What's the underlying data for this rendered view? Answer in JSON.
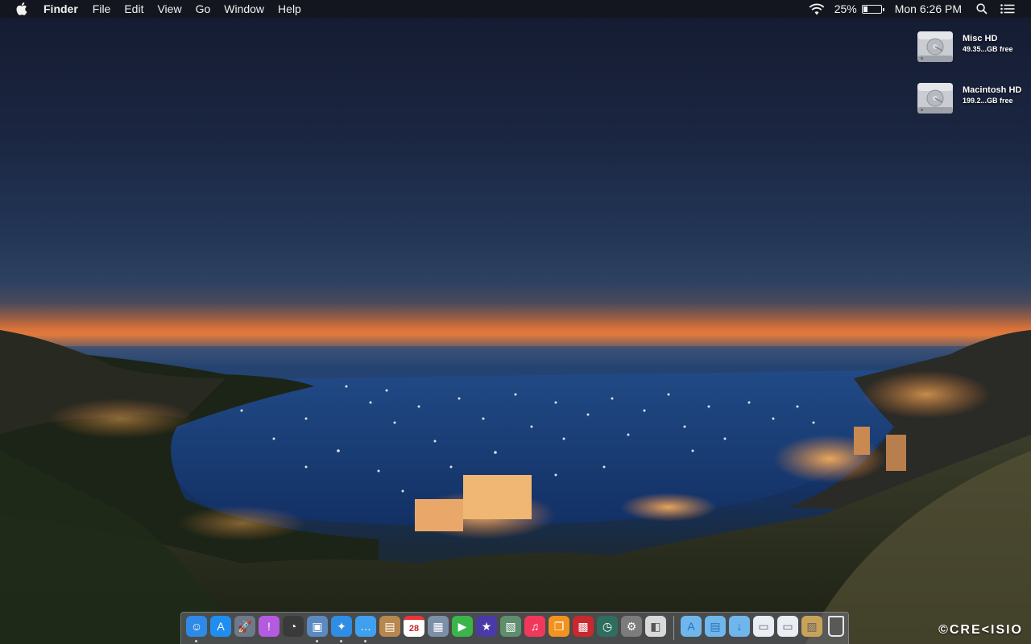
{
  "menubar": {
    "app_name": "Finder",
    "menus": [
      "File",
      "Edit",
      "View",
      "Go",
      "Window",
      "Help"
    ],
    "battery_percent_label": "25%",
    "battery_level": 0.25,
    "clock": "Mon 6:26 PM"
  },
  "desktop_icons": [
    {
      "name": "Misc HD",
      "free": "49.35...GB free",
      "icon": "hard-drive-icon"
    },
    {
      "name": "Macintosh HD",
      "free": "199.2...GB free",
      "icon": "hard-drive-icon"
    }
  ],
  "dock": {
    "apps": [
      {
        "icon": "finder-icon",
        "color": "#2e8ae6",
        "running": true
      },
      {
        "icon": "app-store-icon",
        "color": "#1f8ef0",
        "running": false
      },
      {
        "icon": "launchpad-icon",
        "color": "#6c7a8a",
        "running": false
      },
      {
        "icon": "itunes-connect-icon",
        "color": "#b45be0",
        "running": false
      },
      {
        "icon": "dashboard-icon",
        "color": "#3a3a3a",
        "running": false
      },
      {
        "icon": "preview-icon",
        "color": "#5a8ac0",
        "running": true
      },
      {
        "icon": "safari-icon",
        "color": "#2f8de4",
        "running": true
      },
      {
        "icon": "messages-icon",
        "color": "#3fa0f0",
        "running": true
      },
      {
        "icon": "contacts-icon",
        "color": "#b8874e",
        "running": false
      },
      {
        "icon": "calendar-icon",
        "color": "#ffffff",
        "running": false,
        "label": "28"
      },
      {
        "icon": "photo-browser-icon",
        "color": "#7d8ea8",
        "running": false
      },
      {
        "icon": "facetime-icon",
        "color": "#39b54a",
        "running": false
      },
      {
        "icon": "imovie-icon",
        "color": "#4a3aa8",
        "running": false
      },
      {
        "icon": "image-capture-icon",
        "color": "#5e8e6e",
        "running": false
      },
      {
        "icon": "itunes-icon",
        "color": "#f2385a",
        "running": false
      },
      {
        "icon": "ibooks-icon",
        "color": "#f2921f",
        "running": false
      },
      {
        "icon": "photo-booth-icon",
        "color": "#c8282e",
        "running": false
      },
      {
        "icon": "time-machine-icon",
        "color": "#2f6d5e",
        "running": false
      },
      {
        "icon": "system-preferences-icon",
        "color": "#7c7c7c",
        "running": false
      },
      {
        "icon": "preview-document-icon",
        "color": "#d9d9d9",
        "running": false
      }
    ],
    "stacks": [
      {
        "icon": "applications-folder-icon",
        "color": "#6fb6ec"
      },
      {
        "icon": "documents-folder-icon",
        "color": "#6fb6ec"
      },
      {
        "icon": "downloads-folder-icon",
        "color": "#6fb6ec"
      },
      {
        "icon": "screenshot-stack-icon",
        "color": "#e9eef5"
      },
      {
        "icon": "document-stack-icon",
        "color": "#e9eef5"
      },
      {
        "icon": "picture-stack-icon",
        "color": "#c9a25a"
      },
      {
        "icon": "trash-icon",
        "color": "#d8dbe0"
      }
    ]
  },
  "watermark": "©CRE<ISIO"
}
